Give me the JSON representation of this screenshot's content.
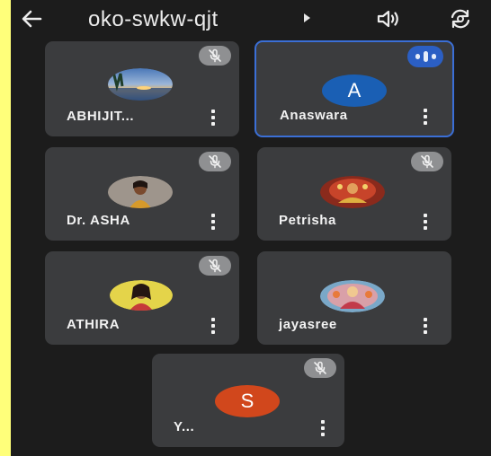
{
  "meeting": {
    "title": "oko-swkw-qjt",
    "back_icon": "arrow-left-icon",
    "speaker_icon": "speaker-icon",
    "switch_camera_icon": "switch-camera-icon"
  },
  "participants": [
    {
      "name": "ABHIJIT...",
      "muted": true,
      "avatar": "photo-sunset"
    },
    {
      "name": "Anaswara",
      "muted": false,
      "speaking": true,
      "avatar_letter": "A",
      "avatar_color": "#1a5fb4"
    },
    {
      "name": "Dr. ASHA",
      "muted": true,
      "avatar": "photo-person"
    },
    {
      "name": "Petrisha",
      "muted": true,
      "avatar": "photo-deity"
    },
    {
      "name": "ATHIRA",
      "muted": true,
      "avatar": "photo-person"
    },
    {
      "name": "jayasree",
      "muted": false,
      "avatar": "photo-deity"
    },
    {
      "name": "Y...",
      "muted": true,
      "avatar_letter": "S",
      "avatar_color": "#d1471c"
    }
  ],
  "colors": {
    "tile_bg": "#3b3c3e",
    "app_bg": "#1c1c1c",
    "active_border": "#3b6fd6",
    "outer_bg": "#ffff7a"
  }
}
